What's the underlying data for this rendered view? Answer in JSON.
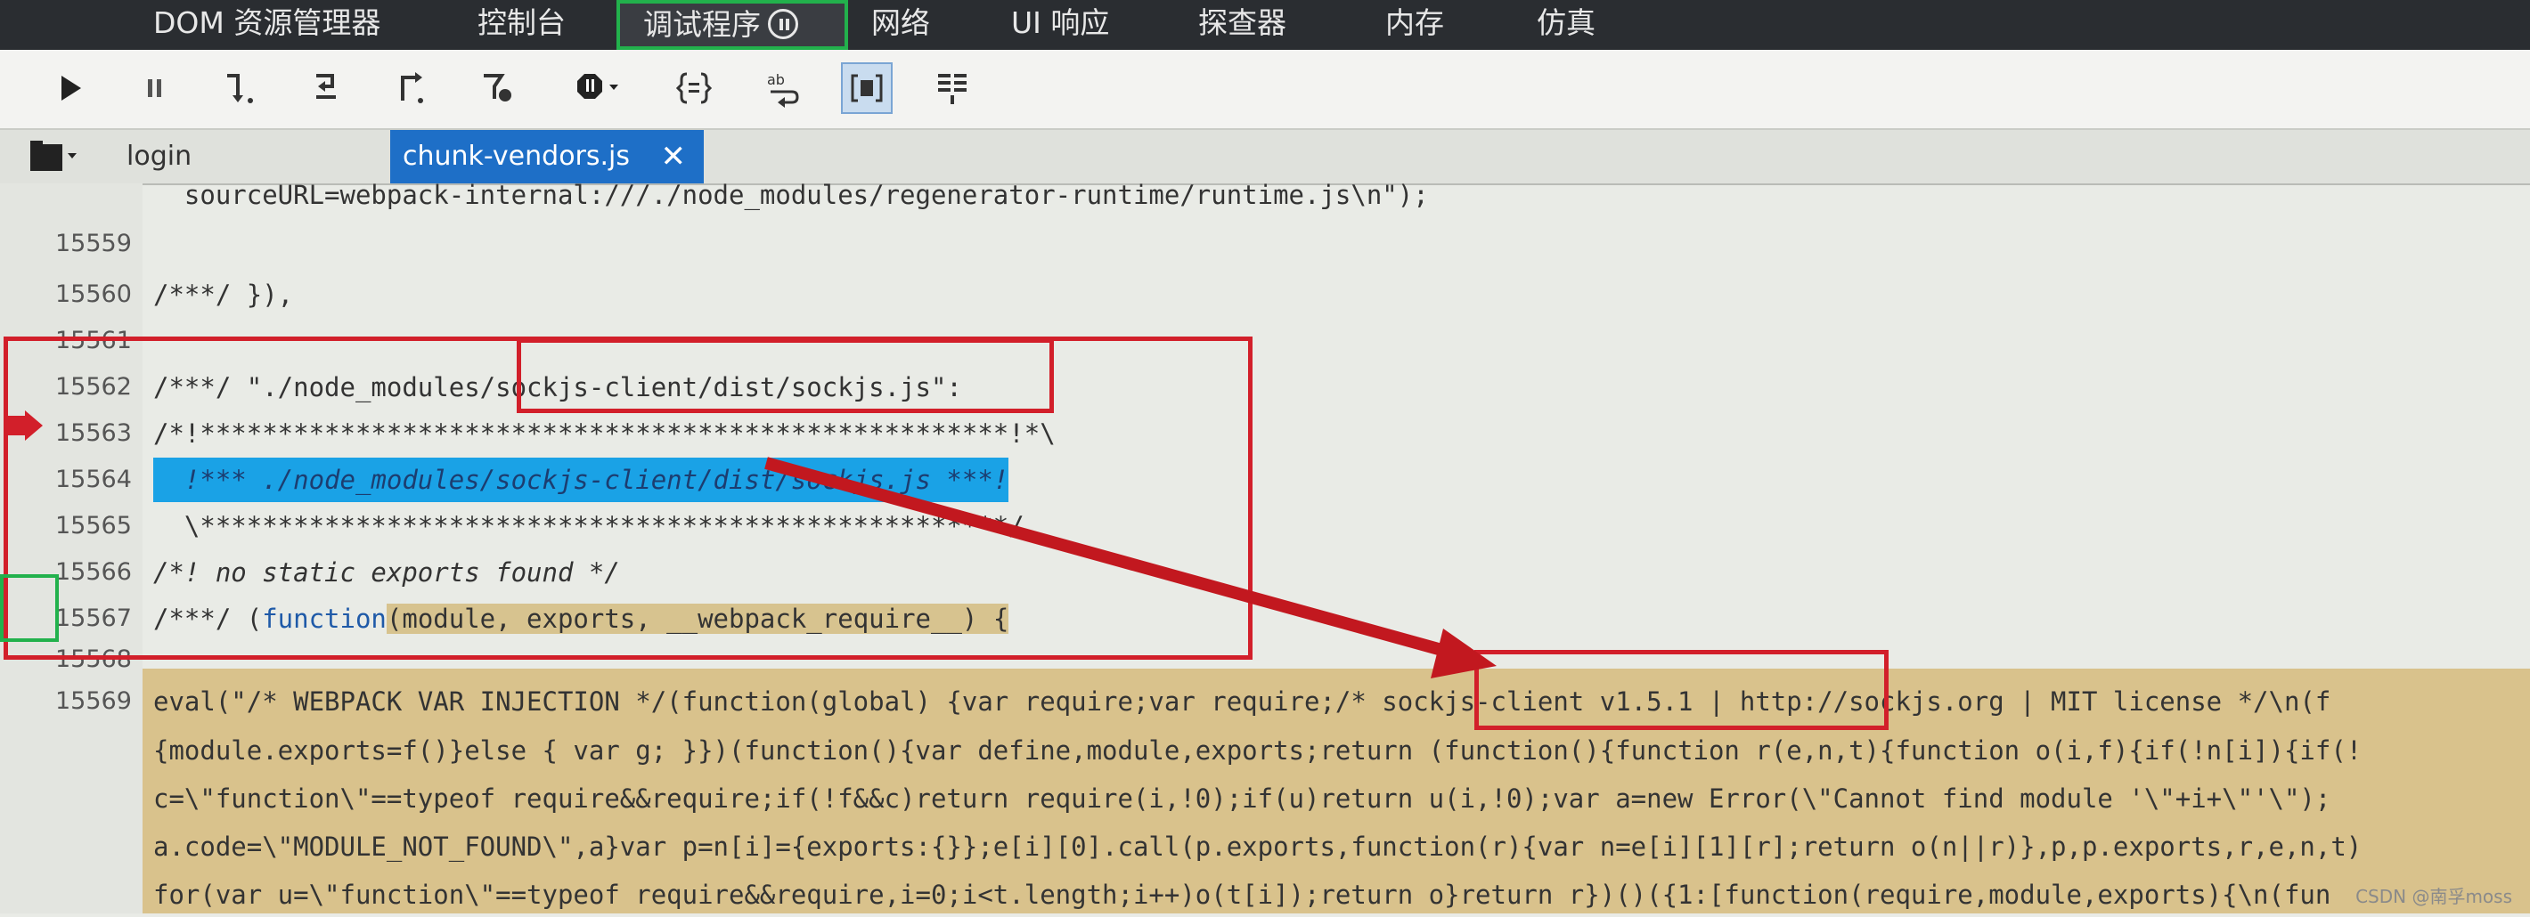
{
  "top_tabs": [
    "DOM 资源管理器",
    "控制台",
    "调试程序",
    "网络",
    "UI 响应",
    "探查器",
    "内存",
    "仿真"
  ],
  "active_top_tab": "调试程序",
  "toolbar_icons": [
    "play-icon",
    "pause-icon",
    "step-over-icon",
    "step-into-icon",
    "step-out-icon",
    "break-on-new-worker-icon",
    "exceptions-icon",
    "pretty-print-icon",
    "word-wrap-icon",
    "just-my-code-icon",
    "source-map-icon"
  ],
  "file_tabs": [
    "login",
    "chunk-vendors.js"
  ],
  "close_glyph": "✕",
  "code": {
    "line0_text": "  sourceURL=webpack-internal:///./node_modules/regenerator-runtime/runtime.js\\n\");",
    "lines": [
      {
        "num": "15559",
        "text": ""
      },
      {
        "num": "15560",
        "text": "/***/ }),"
      },
      {
        "num": "15561",
        "text": ""
      },
      {
        "num": "15562",
        "text": "/***/ \"./node_modules/sockjs-client/dist/sockjs.js\":"
      },
      {
        "num": "15563",
        "text": "/*!****************************************************!*\\"
      },
      {
        "num": "15564",
        "text": "  !*** ./node_modules/sockjs-client/dist/sockjs.js ***!"
      },
      {
        "num": "15565",
        "text": "  \\****************************************************/"
      },
      {
        "num": "15566",
        "text": "/*! no static exports found */"
      },
      {
        "num": "15567",
        "prefix": "/***/ (",
        "kw": "function",
        "rest": "(module, exports, __webpack_require__) {"
      },
      {
        "num": "15568",
        "text": ""
      },
      {
        "num": "15569",
        "text": "eval(\"/* WEBPACK VAR INJECTION */(function(global) {var require;var require;/* sockjs-client v1.5.1 | http://sockjs.org | MIT license */\\n(f"
      }
    ],
    "eval_continuation": [
      "{module.exports=f()}else { var g; }})(function(){var define,module,exports;return (function(){function r(e,n,t){function o(i,f){if(!n[i]){if(!",
      "c=\\\"function\\\"==typeof require&&require;if(!f&&c)return require(i,!0);if(u)return u(i,!0);var a=new Error(\\\"Cannot find module '\\\"+i+\\\"'\\\");",
      "a.code=\\\"MODULE_NOT_FOUND\\\",a}var p=n[i]={exports:{}};e[i][0].call(p.exports,function(r){var n=e[i][1][r];return o(n||r)},p,p.exports,r,e,n,t)",
      "for(var u=\\\"function\\\"==typeof require&&require,i=0;i<t.length;i++)o(t[i]);return o}return r})()({1:[function(require,module,exports){\\n(fun"
    ]
  },
  "watermark": "CSDN @南孚moss"
}
